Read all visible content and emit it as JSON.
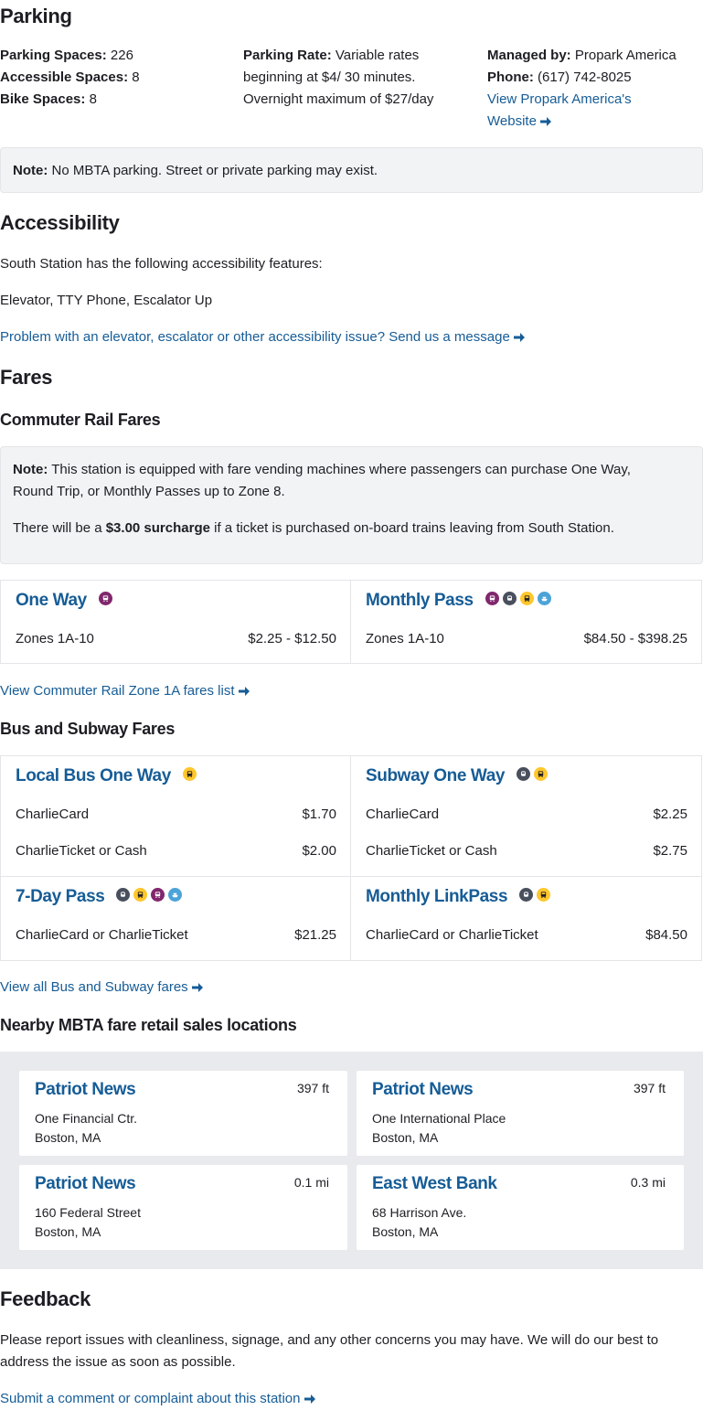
{
  "parking": {
    "heading": "Parking",
    "spaces_label": "Parking Spaces:",
    "spaces_value": "226",
    "accessible_label": "Accessible Spaces:",
    "accessible_value": "8",
    "bike_label": "Bike Spaces:",
    "bike_value": "8",
    "rate_label": "Parking Rate:",
    "rate_line1": "Variable rates",
    "rate_line2": "beginning at $4/ 30 minutes.",
    "rate_line3": "Overnight maximum of $27/day",
    "managed_label": "Managed by:",
    "managed_value": "Propark America",
    "phone_label": "Phone:",
    "phone_value": "(617) 742-8025",
    "website_link_line1": "View Propark America's",
    "website_link_line2": "Website",
    "note_label": "Note:",
    "note_text": "No MBTA parking. Street or private parking may exist."
  },
  "accessibility": {
    "heading": "Accessibility",
    "intro": "South Station has the following accessibility features:",
    "features": "Elevator, TTY Phone, Escalator Up",
    "report_link": "Problem with an elevator, escalator or other accessibility issue? Send us a message"
  },
  "fares": {
    "heading": "Fares",
    "commuter_heading": "Commuter Rail Fares",
    "note_label": "Note:",
    "note_text_line1": "This station is equipped with fare vending machines where passengers can purchase One Way,",
    "note_text_line2": "Round Trip, or Monthly Passes up to Zone 8.",
    "surcharge_pre": "There will be a",
    "surcharge_bold": "$3.00 surcharge",
    "surcharge_post": "if a ticket is purchased on-board trains leaving from South Station.",
    "commuter_cards": [
      {
        "title": "One Way",
        "label": "Zones 1A-10",
        "value": "$2.25 - $12.50"
      },
      {
        "title": "Monthly Pass",
        "label": "Zones 1A-10",
        "value": "$84.50 - $398.25"
      }
    ],
    "commuter_link": "View Commuter Rail Zone 1A fares list",
    "bus_heading": "Bus and Subway Fares",
    "bus_cards": [
      {
        "title": "Local Bus One Way",
        "rows": [
          {
            "label": "CharlieCard",
            "value": "$1.70"
          },
          {
            "label": "CharlieTicket or Cash",
            "value": "$2.00"
          }
        ]
      },
      {
        "title": "Subway One Way",
        "rows": [
          {
            "label": "CharlieCard",
            "value": "$2.25"
          },
          {
            "label": "CharlieTicket or Cash",
            "value": "$2.75"
          }
        ]
      },
      {
        "title": "7-Day Pass",
        "rows": [
          {
            "label": "CharlieCard or CharlieTicket",
            "value": "$21.25"
          }
        ]
      },
      {
        "title": "Monthly LinkPass",
        "rows": [
          {
            "label": "CharlieCard or CharlieTicket",
            "value": "$84.50"
          }
        ]
      }
    ],
    "bus_link": "View all Bus and Subway fares",
    "retail_heading": "Nearby MBTA fare retail sales locations",
    "retail": [
      {
        "name": "Patriot News",
        "distance": "397 ft",
        "address1": "One Financial Ctr.",
        "address2": "Boston, MA"
      },
      {
        "name": "Patriot News",
        "distance": "397 ft",
        "address1": "One International Place",
        "address2": "Boston, MA"
      },
      {
        "name": "Patriot News",
        "distance": "0.1 mi",
        "address1": "160 Federal Street",
        "address2": "Boston, MA"
      },
      {
        "name": "East West Bank",
        "distance": "0.3 mi",
        "address1": "68 Harrison Ave.",
        "address2": "Boston, MA"
      }
    ]
  },
  "feedback": {
    "heading": "Feedback",
    "text_line1": "Please report issues with cleanliness, signage, and any other concerns you may have. We will do our best to",
    "text_line2": "address the issue as soon as possible.",
    "link": "Submit a comment or complaint about this station"
  },
  "icons": {
    "arrow": "arrow-right-icon",
    "commuter_rail_badge": "commuter-rail-icon",
    "subway_badge": "subway-icon",
    "bus_badge": "bus-icon",
    "ferry_badge": "ferry-icon"
  },
  "colors": {
    "link": "#165c96",
    "commuter_rail": "#80276c",
    "subway": "#494f5c",
    "bus": "#ffc72c",
    "ferry": "#4ba3d8",
    "note_bg": "#f2f3f5",
    "retail_bg": "#e9eaed"
  }
}
